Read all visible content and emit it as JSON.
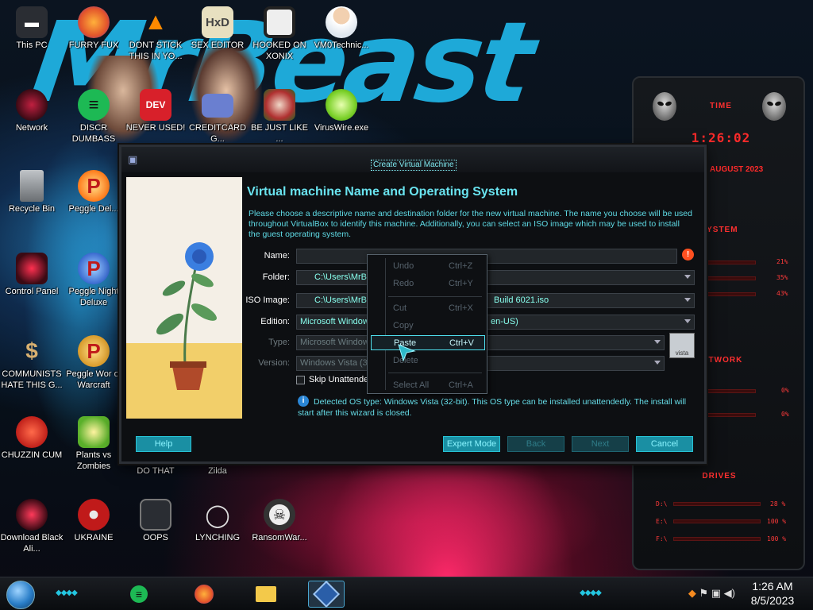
{
  "desktop": {
    "icons": [
      {
        "label": "This PC",
        "glyph": "pc-icon"
      },
      {
        "label": "FURRY FUX",
        "glyph": "firefox-icon"
      },
      {
        "label": "DONT STICK THIS IN YO...",
        "glyph": "vlc-cone-icon"
      },
      {
        "label": "SEX EDITOR",
        "glyph": "hxd-icon"
      },
      {
        "label": "HOOKED ON XONIX",
        "glyph": "xonix-icon"
      },
      {
        "label": "VM0Technic...",
        "glyph": "doctor-icon"
      },
      {
        "label": "Network",
        "glyph": "network-icon"
      },
      {
        "label": "DISCR DUMBASS",
        "glyph": "spotify-icon"
      },
      {
        "label": "NEVER USED!",
        "glyph": "devcpp-icon"
      },
      {
        "label": "CREDITCARD G...",
        "glyph": "creditcard-icon"
      },
      {
        "label": "BE JUST LIKE ...",
        "glyph": "santa-icon"
      },
      {
        "label": "VirusWire.exe",
        "glyph": "lime-icon"
      },
      {
        "label": "Recycle Bin",
        "glyph": "recycle-bin-icon"
      },
      {
        "label": "Peggle Del...",
        "glyph": "peggle-icon"
      },
      {
        "label": "Control Panel",
        "glyph": "control-panel-icon"
      },
      {
        "label": "Peggle Night Deluxe",
        "glyph": "peggle-icon"
      },
      {
        "label": "COMMUNISTS HATE THIS G...",
        "glyph": "money-bag-icon"
      },
      {
        "label": "Peggle Wor of Warcraft",
        "glyph": "peggle-icon"
      },
      {
        "label": "CHUZZIN CUM",
        "glyph": "chuzzle-icon"
      },
      {
        "label": "Plants vs Zombies",
        "glyph": "pvz-icon"
      },
      {
        "label": "DO THAT",
        "glyph": "blank-icon"
      },
      {
        "label": "Zilda",
        "glyph": "blank-icon"
      },
      {
        "label": "Download Black Ali...",
        "glyph": "alienware-icon"
      },
      {
        "label": "UKRAINE",
        "glyph": "radiation-icon"
      },
      {
        "label": "OOPS",
        "glyph": "oops-icon"
      },
      {
        "label": "LYNCHING",
        "glyph": "rope-icon"
      },
      {
        "label": "RansomWar...",
        "glyph": "skull-icon"
      }
    ]
  },
  "wallpaper": {
    "text": "MrBeast"
  },
  "dialog": {
    "title": "Create Virtual Machine",
    "heading": "Virtual machine Name and Operating System",
    "description": "Please choose a descriptive name and destination folder for the new virtual machine. The name you choose will be used throughout VirtualBox to identify this machine. Additionally, you can select an ISO image which may be used to install the guest operating system.",
    "fields": {
      "name_label": "Name:",
      "name_value": "",
      "folder_label": "Folder:",
      "folder_value": "C:\\Users\\MrBe",
      "iso_label": "ISO Image:",
      "iso_value_left": "C:\\Users\\MrBe",
      "iso_value_right": "Build 6021.iso",
      "edition_label": "Edition:",
      "edition_value_left": "Microsoft Windows",
      "edition_value_right": "en-US)",
      "type_label": "Type:",
      "type_value": "Microsoft Window",
      "version_label": "Version:",
      "version_value": "Windows Vista (32-"
    },
    "vista_badge": "vista",
    "skip_unattended_label": "Skip Unattende",
    "skip_unattended_checked": false,
    "info_text": "Detected OS type: Windows Vista (32-bit). This OS type can be installed unattendedly. The install will start after this wizard is closed.",
    "buttons": {
      "help": "Help",
      "expert": "Expert Mode",
      "back": "Back",
      "next": "Next",
      "cancel": "Cancel"
    }
  },
  "context_menu": {
    "items": [
      {
        "label": "Undo",
        "shortcut": "Ctrl+Z",
        "enabled": false
      },
      {
        "label": "Redo",
        "shortcut": "Ctrl+Y",
        "enabled": false
      },
      {
        "label": "Cut",
        "shortcut": "Ctrl+X",
        "enabled": false
      },
      {
        "label": "Copy",
        "shortcut": "",
        "enabled": false
      },
      {
        "label": "Paste",
        "shortcut": "Ctrl+V",
        "enabled": true
      },
      {
        "label": "Delete",
        "shortcut": "",
        "enabled": false
      },
      {
        "label": "Select All",
        "shortcut": "Ctrl+A",
        "enabled": false
      }
    ]
  },
  "gadget": {
    "time_label": "TIME",
    "time": "1:26:02",
    "date": "AUGUST 2023",
    "system_label": "SYSTEM",
    "system_values": [
      "21%",
      "35%",
      "43%"
    ],
    "network_label": "NETWORK",
    "network_values": [
      "0%",
      "0%"
    ],
    "drives_label": "DRIVES",
    "drives": [
      {
        "letter": "D:\\",
        "value": "28 %"
      },
      {
        "letter": "E:\\",
        "value": "100 %"
      },
      {
        "letter": "F:\\",
        "value": "100 %"
      }
    ],
    "accent": "#ff2a2a"
  },
  "taskbar": {
    "clock_time": "1:26 AM",
    "clock_date": "8/5/2023",
    "pinned": [
      "spotify-icon",
      "firefox-icon",
      "file-explorer-icon",
      "virtualbox-icon"
    ],
    "accent": "#24c6e0"
  }
}
